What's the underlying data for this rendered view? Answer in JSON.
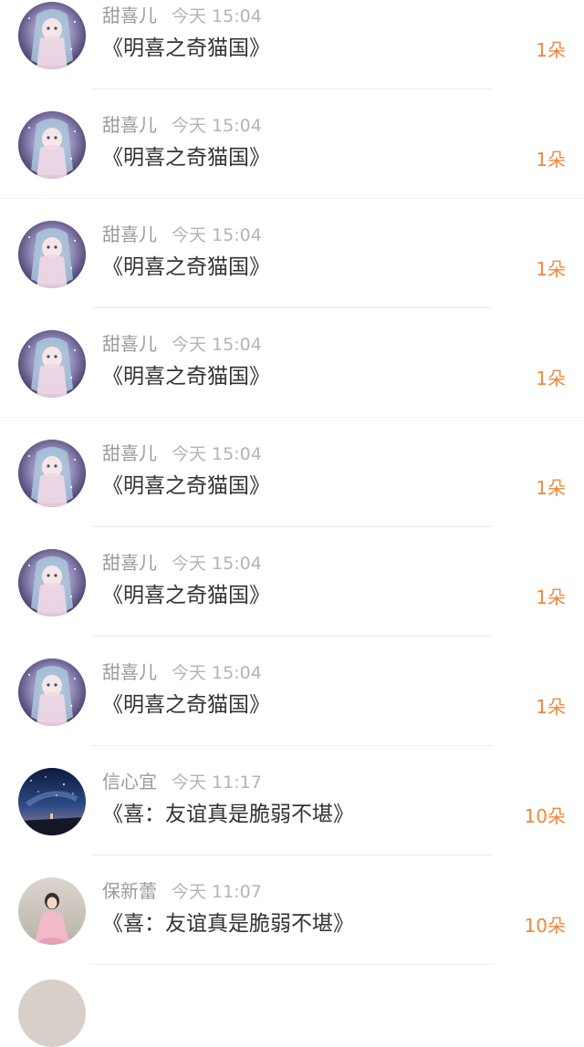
{
  "gift_list": {
    "items": [
      {
        "user": "甜喜儿",
        "time": "今天 15:04",
        "book": "《明喜之奇猫国》",
        "gift": "1朵",
        "avatar": "anime-girl-avatar"
      },
      {
        "user": "甜喜儿",
        "time": "今天 15:04",
        "book": "《明喜之奇猫国》",
        "gift": "1朵",
        "avatar": "anime-girl-avatar"
      },
      {
        "user": "甜喜儿",
        "time": "今天 15:04",
        "book": "《明喜之奇猫国》",
        "gift": "1朵",
        "avatar": "anime-girl-avatar"
      },
      {
        "user": "甜喜儿",
        "time": "今天 15:04",
        "book": "《明喜之奇猫国》",
        "gift": "1朵",
        "avatar": "anime-girl-avatar"
      },
      {
        "user": "甜喜儿",
        "time": "今天 15:04",
        "book": "《明喜之奇猫国》",
        "gift": "1朵",
        "avatar": "anime-girl-avatar"
      },
      {
        "user": "甜喜儿",
        "time": "今天 15:04",
        "book": "《明喜之奇猫国》",
        "gift": "1朵",
        "avatar": "anime-girl-avatar"
      },
      {
        "user": "甜喜儿",
        "time": "今天 15:04",
        "book": "《明喜之奇猫国》",
        "gift": "1朵",
        "avatar": "anime-girl-avatar"
      },
      {
        "user": "信心宜",
        "time": "今天 11:17",
        "book": "《喜：友谊真是脆弱不堪》",
        "gift": "10朵",
        "avatar": "starry-night-avatar"
      },
      {
        "user": "保新蕾",
        "time": "今天 11:07",
        "book": "《喜：友谊真是脆弱不堪》",
        "gift": "10朵",
        "avatar": "girl-photo-avatar"
      }
    ]
  },
  "colors": {
    "gift_accent": "#f0873c",
    "name_gray": "#9b9b9b",
    "title_text": "#333333"
  }
}
